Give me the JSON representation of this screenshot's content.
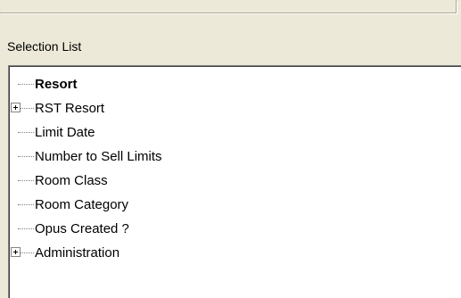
{
  "selection_list": {
    "label": "Selection List",
    "items": [
      {
        "label": "Resort",
        "bold": true,
        "expandable": false
      },
      {
        "label": "RST  Resort",
        "bold": false,
        "expandable": true
      },
      {
        "label": "Limit Date",
        "bold": false,
        "expandable": false
      },
      {
        "label": "Number to Sell Limits",
        "bold": false,
        "expandable": false
      },
      {
        "label": "Room Class",
        "bold": false,
        "expandable": false
      },
      {
        "label": "Room Category",
        "bold": false,
        "expandable": false
      },
      {
        "label": "Opus Created ?",
        "bold": false,
        "expandable": false
      },
      {
        "label": "Administration",
        "bold": false,
        "expandable": true
      }
    ]
  }
}
